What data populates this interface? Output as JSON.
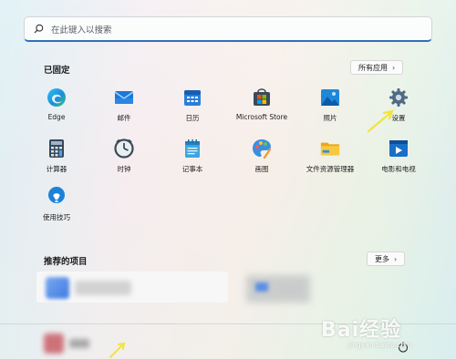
{
  "search": {
    "placeholder": "在此键入以搜索"
  },
  "pinned": {
    "title": "已固定",
    "all_apps_label": "所有应用",
    "apps": [
      {
        "label": "Edge",
        "icon": "edge-icon"
      },
      {
        "label": "邮件",
        "icon": "mail-icon"
      },
      {
        "label": "日历",
        "icon": "calendar-icon"
      },
      {
        "label": "Microsoft Store",
        "icon": "store-icon"
      },
      {
        "label": "照片",
        "icon": "photos-icon"
      },
      {
        "label": "设置",
        "icon": "settings-icon"
      },
      {
        "label": "计算器",
        "icon": "calculator-icon"
      },
      {
        "label": "时钟",
        "icon": "clock-icon"
      },
      {
        "label": "记事本",
        "icon": "notepad-icon"
      },
      {
        "label": "画图",
        "icon": "paint-icon"
      },
      {
        "label": "文件资源管理器",
        "icon": "folder-icon"
      },
      {
        "label": "电影和电视",
        "icon": "movies-icon"
      },
      {
        "label": "使用技巧",
        "icon": "tips-icon"
      }
    ]
  },
  "recommended": {
    "title": "推荐的项目",
    "more_label": "更多"
  },
  "watermark": {
    "text": "Bai经验",
    "sub": "jingyan.baidu.com"
  },
  "colors": {
    "accent": "#2e6fb8",
    "annotation_arrow": "#f2e43a"
  }
}
